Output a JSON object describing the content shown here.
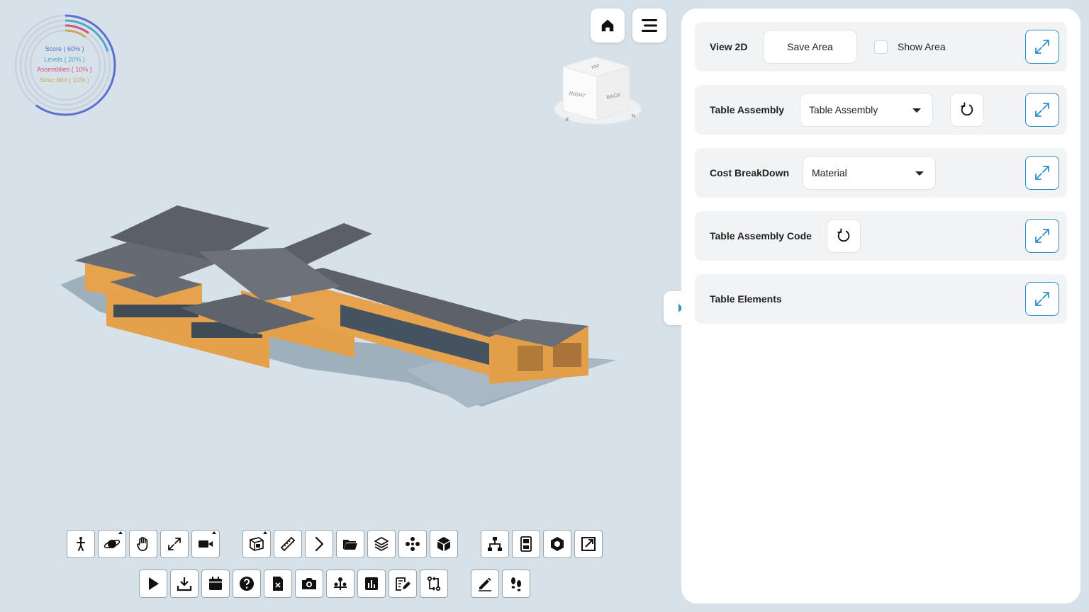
{
  "score_rings": {
    "labels": [
      {
        "text": "Score ( 60% )",
        "color": "#5b6fd0",
        "percent": 60
      },
      {
        "text": "Levels ( 20% )",
        "color": "#4aa8c9",
        "percent": 20
      },
      {
        "text": "Assemblies ( 10% )",
        "color": "#d9507a",
        "percent": 10
      },
      {
        "text": "Struc Mtrl ( 10% )",
        "color": "#c9a85a",
        "percent": 10
      }
    ]
  },
  "top_buttons": {
    "home_icon": "home-icon",
    "menu_icon": "menu-icon"
  },
  "viewcube": {
    "top": "TOP",
    "right": "RIGHT",
    "back": "BACK",
    "compass_e": "E",
    "compass_n": "N"
  },
  "panel": {
    "view2d": {
      "label": "View 2D",
      "save_area": "Save Area",
      "show_area": "Show Area",
      "show_area_checked": false
    },
    "table_assembly": {
      "label": "Table Assembly",
      "selected": "Table Assembly"
    },
    "cost_breakdown": {
      "label": "Cost BreakDown",
      "selected": "Material"
    },
    "table_assembly_code": {
      "label": "Table Assembly Code"
    },
    "table_elements": {
      "label": "Table Elements"
    }
  },
  "colors": {
    "accent": "#2f8fc7",
    "background": "#d7e1ea",
    "panel": "#ffffff",
    "row": "#f1f3f5"
  },
  "toolbar_icons": {
    "row1": [
      "walk-icon",
      "orbit-icon",
      "pan-hand-icon",
      "fit-icon",
      "camera-video-icon",
      "section-box-icon",
      "measure-ruler-icon",
      "chevron-right-icon",
      "folder-icon",
      "layers-icon",
      "explode-icon",
      "cube-icon",
      "hierarchy-icon",
      "properties-icon",
      "hexagon-icon",
      "resize-icon"
    ],
    "row2": [
      "play-icon",
      "download-icon",
      "calendar-icon",
      "help-icon",
      "file-x-icon",
      "camera-icon",
      "pins-icon",
      "chart-icon",
      "edit-list-icon",
      "compare-icon",
      "pencil-icon",
      "footprints-icon"
    ]
  }
}
